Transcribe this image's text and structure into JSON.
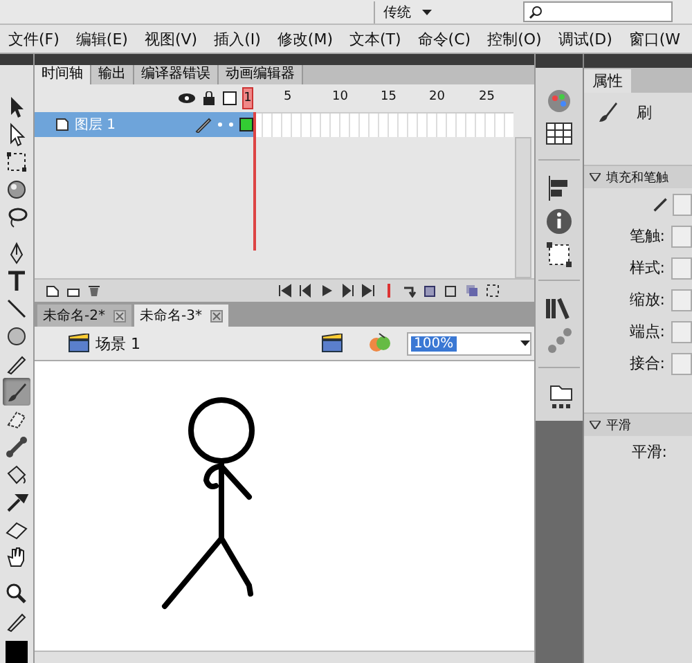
{
  "title_bar": {
    "workspace": "传统"
  },
  "menu": [
    "文件(F)",
    "编辑(E)",
    "视图(V)",
    "插入(I)",
    "修改(M)",
    "文本(T)",
    "命令(C)",
    "控制(O)",
    "调试(D)",
    "窗口(W"
  ],
  "tools": [
    {
      "kind": "arrow",
      "selected": false
    },
    {
      "kind": "subselect",
      "selected": false
    },
    {
      "kind": "transform",
      "selected": false
    },
    {
      "kind": "sphere",
      "selected": false
    },
    {
      "kind": "lasso",
      "selected": false
    },
    {
      "kind": "pen",
      "selected": false
    },
    {
      "kind": "text",
      "selected": false
    },
    {
      "kind": "line",
      "selected": false
    },
    {
      "kind": "oval",
      "selected": false
    },
    {
      "kind": "pencil",
      "selected": false
    },
    {
      "kind": "brush",
      "selected": true
    },
    {
      "kind": "deco",
      "selected": false
    },
    {
      "kind": "bone",
      "selected": false
    },
    {
      "kind": "bucket",
      "selected": false
    },
    {
      "kind": "dropper",
      "selected": false
    },
    {
      "kind": "eraser",
      "selected": false
    },
    {
      "kind": "hand",
      "selected": false
    },
    {
      "kind": "zoom",
      "selected": false
    },
    {
      "kind": "stroke",
      "selected": false
    },
    {
      "kind": "fill",
      "selected": false
    }
  ],
  "timeline": {
    "tabs": [
      {
        "label": "时间轴",
        "selected": true
      },
      {
        "label": "输出",
        "selected": false
      },
      {
        "label": "编译器错误",
        "selected": false
      },
      {
        "label": "动画编辑器",
        "selected": false
      }
    ],
    "frame_numbers": [
      "1",
      "5",
      "10",
      "15",
      "20",
      "25"
    ],
    "layers": [
      {
        "name": "图层 1",
        "selected": true
      }
    ]
  },
  "documents": [
    {
      "label": "未命名-2*",
      "selected": false
    },
    {
      "label": "未命名-3*",
      "selected": true
    }
  ],
  "scene": {
    "name": "场景 1",
    "zoom": "100%"
  },
  "properties": {
    "tab": "属性",
    "tool_name": "刷",
    "sections": [
      {
        "title": "填充和笔触",
        "fields": [
          "笔触:",
          "样式:",
          "缩放:",
          "端点:",
          "接合:"
        ]
      },
      {
        "title": "平滑",
        "fields": [
          "平滑:"
        ]
      }
    ]
  }
}
